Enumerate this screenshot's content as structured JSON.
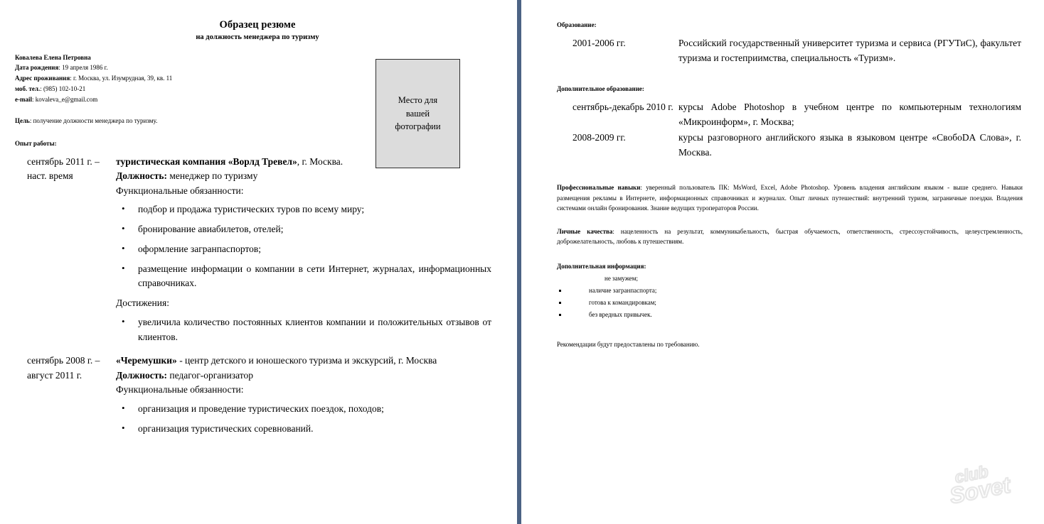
{
  "document": {
    "title": "Образец резюме",
    "subtitle": "на должность менеджера по туризму"
  },
  "colors": {
    "divider": "#4c6384",
    "photo_box_fill": "#dcdcdc",
    "photo_box_border": "#2e2e2e",
    "watermark": "#e8e8e8"
  },
  "photo_placeholder": {
    "line1": "Место для",
    "line2": "вашей",
    "line3": "фотографии"
  },
  "contact": {
    "name": "Ковалева Елена Петровна",
    "birth_label": "Дата рождения",
    "birth_value": ": 19 апреля 1986 г.",
    "address_label": "Адрес проживания",
    "address_value": ": г. Москва, ул. Изумрудная, 39, кв. 11",
    "phone_label": "моб. тел.",
    "phone_value": ": (985) 102-10-21",
    "email_label": "e-mail",
    "email_value": ": kovaleva_e@gmail.com"
  },
  "goal": {
    "label": "Цель",
    "value": ": получение должности менеджера по туризму."
  },
  "work": {
    "heading": "Опыт работы:",
    "jobs": [
      {
        "dates": "сентябрь 2011 г. –\nнаст. время",
        "company": "туристическая компания «Ворлд Тревел»",
        "company_tail": ", г. Москва.",
        "position_label": "Должность:",
        "position_value": " менеджер по туризму",
        "duties_label": "Функциональные обязанности:",
        "duties": [
          "подбор и продажа туристических туров по всему миру;",
          "бронирование авиабилетов, отелей;",
          "оформление загранпаспортов;",
          "размещение информации о компании в сети Интернет, журналах, информационных справочниках."
        ],
        "achievements_label": "Достижения:",
        "achievements": [
          "увеличила количество постоянных клиентов компании и положительных отзывов от клиентов."
        ]
      },
      {
        "dates": "сентябрь 2008 г. –\nавгуст 2011 г.",
        "company": "«Черемушки»",
        "company_tail": " - центр детского и юношеского туризма и экскурсий, г. Москва",
        "position_label": "Должность:",
        "position_value": " педагог-организатор",
        "duties_label": "Функциональные обязанности:",
        "duties": [
          "организация и проведение туристических поездок, походов;",
          "организация туристических соревнований."
        ],
        "achievements_label": "",
        "achievements": []
      }
    ]
  },
  "education": {
    "heading": "Образование:",
    "items": [
      {
        "dates": "2001-2006 гг.",
        "text": "Российский государственный университет туризма и сервиса (РГУТиС), факультет туризма и гостеприимства, специальность «Туризм»."
      }
    ]
  },
  "additional_education": {
    "heading": "Дополнительное образование:",
    "items": [
      {
        "dates": "сентябрь-декабрь 2010 г.",
        "text": "курсы Adobe Photoshop в учебном центре по компьютерным технологиям «Микроинформ», г. Москва;"
      },
      {
        "dates": "2008-2009 гг.",
        "text": "курсы разговорного английского языка в языковом центре «СвобоDA Слова», г. Москва."
      }
    ]
  },
  "skills": {
    "label": "Профессиональные навыки",
    "text": ": уверенный пользователь ПК: MsWord, Excel, Adobe Photoshop. Уровень владения английским языком - выше среднего. Навыки размещения рекламы в Интернете, информационных справочниках и журналах. Опыт личных путешествий: внутренний туризм, заграничные поездки. Владения системами онлайн бронирования. Знание ведущих туроператоров России."
  },
  "personal_qualities": {
    "label": "Личные качества",
    "text": ":  нацеленность на результат, коммуникабельность, быстрая обучаемость, ответственность, стрессоустойчивость, целеустремленность, доброжелательность, любовь к путешествиям."
  },
  "additional_info": {
    "heading": "Дополнительная информация:",
    "items": [
      {
        "text": "не замужем;",
        "bulleted": false
      },
      {
        "text": "наличие загранпаспорта;",
        "bulleted": true
      },
      {
        "text": "готова к командировкам;",
        "bulleted": true
      },
      {
        "text": "без вредных привычек.",
        "bulleted": true
      }
    ]
  },
  "references": {
    "text": "Рекомендации будут предоставлены по требованию."
  },
  "watermark": {
    "line1": "club",
    "line2": "Sovet"
  }
}
